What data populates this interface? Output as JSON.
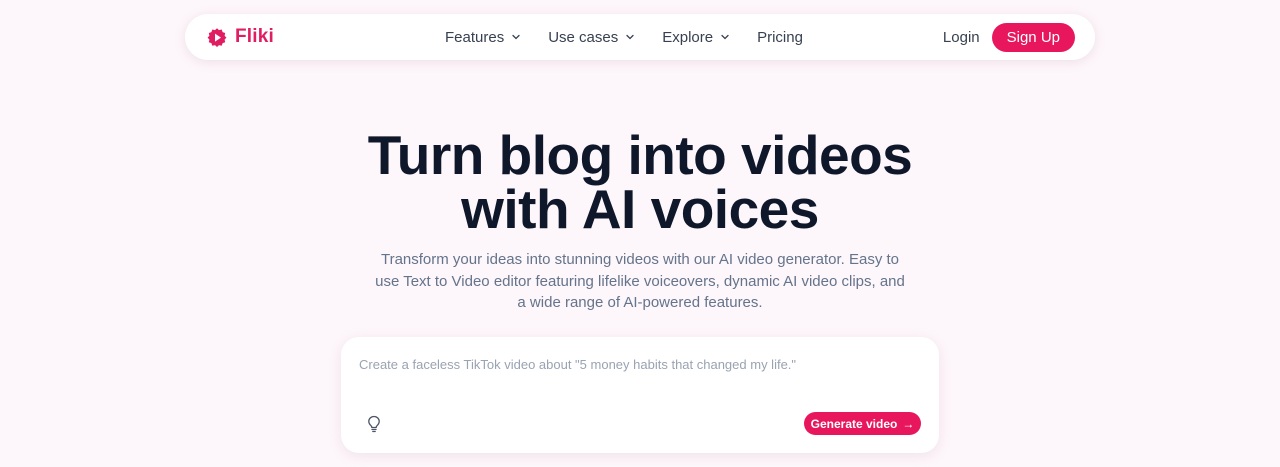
{
  "brand": {
    "name": "Fliki",
    "color": "#e11d62",
    "icon": "play-circle-icon"
  },
  "nav": {
    "items": [
      {
        "label": "Features",
        "dropdown": true
      },
      {
        "label": "Use cases",
        "dropdown": true
      },
      {
        "label": "Explore",
        "dropdown": true
      },
      {
        "label": "Pricing",
        "dropdown": false
      }
    ],
    "login_label": "Login",
    "signup_label": "Sign Up"
  },
  "hero": {
    "title_line1": "Turn blog into videos",
    "title_line2": "with AI voices",
    "subtitle": "Transform your ideas into stunning videos with our AI video generator. Easy to use Text to Video editor featuring lifelike voiceovers, dynamic AI video clips, and a wide range of AI-powered features."
  },
  "prompt": {
    "placeholder": "Create a faceless TikTok video about \"5 money habits that changed my life.\"",
    "value": "",
    "idea_icon": "lightbulb-icon",
    "generate_label": "Generate video",
    "generate_icon": "arrow-right-icon"
  },
  "colors": {
    "accent": "#e8175d",
    "background": "#fdf6fa",
    "heading": "#0f172a",
    "muted": "#64748b"
  }
}
